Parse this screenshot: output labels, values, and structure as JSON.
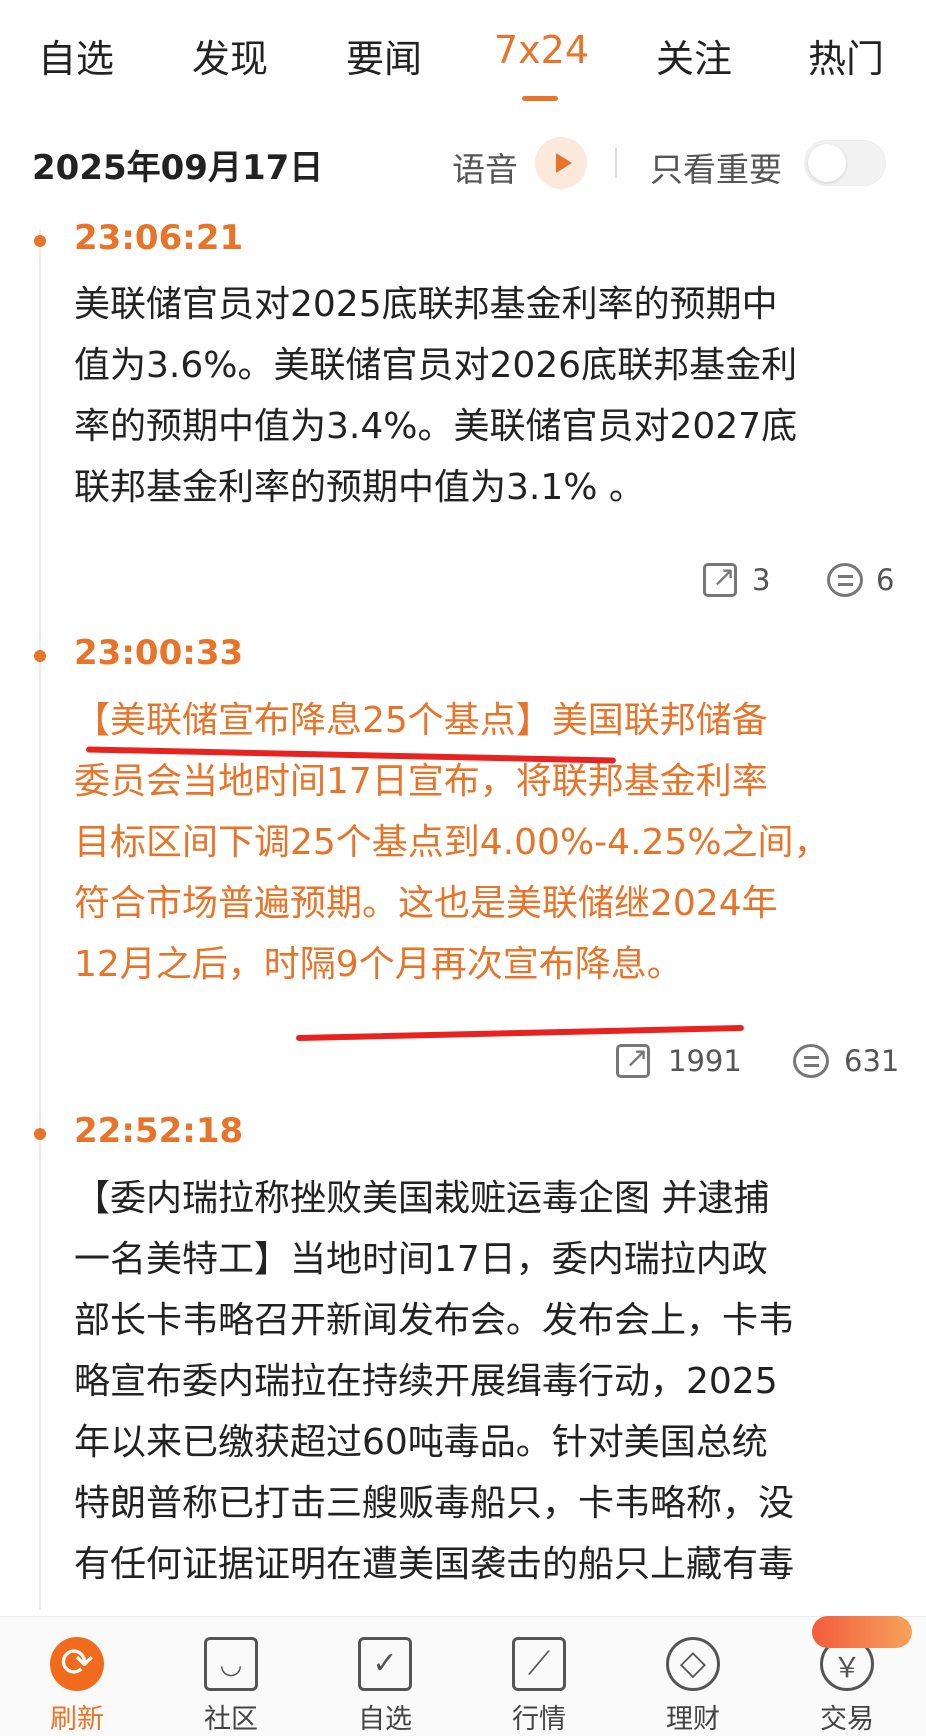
{
  "tabs": [
    {
      "label": "自选"
    },
    {
      "label": "发现"
    },
    {
      "label": "要闻"
    },
    {
      "label": "7x24"
    },
    {
      "label": "关注"
    },
    {
      "label": "热门"
    }
  ],
  "active_tab": "7x24",
  "header": {
    "date": "2025年09月17日",
    "voice_label": "语音",
    "important_only_label": "只看重要"
  },
  "news": [
    {
      "time": "23:06:21",
      "lines": [
        "美联储官员对2025底联邦基金利率的预期中",
        "值为3.6%。美联储官员对2026底联邦基金利",
        "率的预期中值为3.4%。美联储官员对2027底",
        "联邦基金利率的预期中值为3.1% 。"
      ],
      "shares": "3",
      "comments": "6"
    },
    {
      "time": "23:00:33",
      "lines": [
        "【美联储宣布降息25个基点】美国联邦储备",
        "委员会当地时间17日宣布，将联邦基金利率",
        "目标区间下调25个基点到4.00%-4.25%之间，",
        "符合市场普遍预期。这也是美联储继2024年",
        "12月之后，时隔9个月再次宣布降息。"
      ],
      "shares": "1991",
      "comments": "631"
    },
    {
      "time": "22:52:18",
      "lines": [
        "【委内瑞拉称挫败美国栽赃运毒企图 并逮捕",
        "一名美特工】当地时间17日，委内瑞拉内政",
        "部长卡韦略召开新闻发布会。发布会上，卡韦",
        "略宣布委内瑞拉在持续开展缉毒行动，2025",
        "年以来已缴获超过60吨毒品。针对美国总统",
        "特朗普称已打击三艘贩毒船只，卡韦略称，没",
        "有任何证据证明在遭美国袭击的船只上藏有毒"
      ]
    }
  ],
  "bottom_nav": [
    {
      "label": "刷新",
      "icon": "refresh-icon"
    },
    {
      "label": "社区",
      "icon": "community-icon"
    },
    {
      "label": "自选",
      "icon": "watchlist-icon"
    },
    {
      "label": "行情",
      "icon": "market-icon"
    },
    {
      "label": "理财",
      "icon": "wealth-icon"
    },
    {
      "label": "交易",
      "icon": "trade-icon"
    }
  ],
  "colors": {
    "accent": "#e8742a",
    "highlight_underline": "#e8221f",
    "text": "#222222"
  }
}
